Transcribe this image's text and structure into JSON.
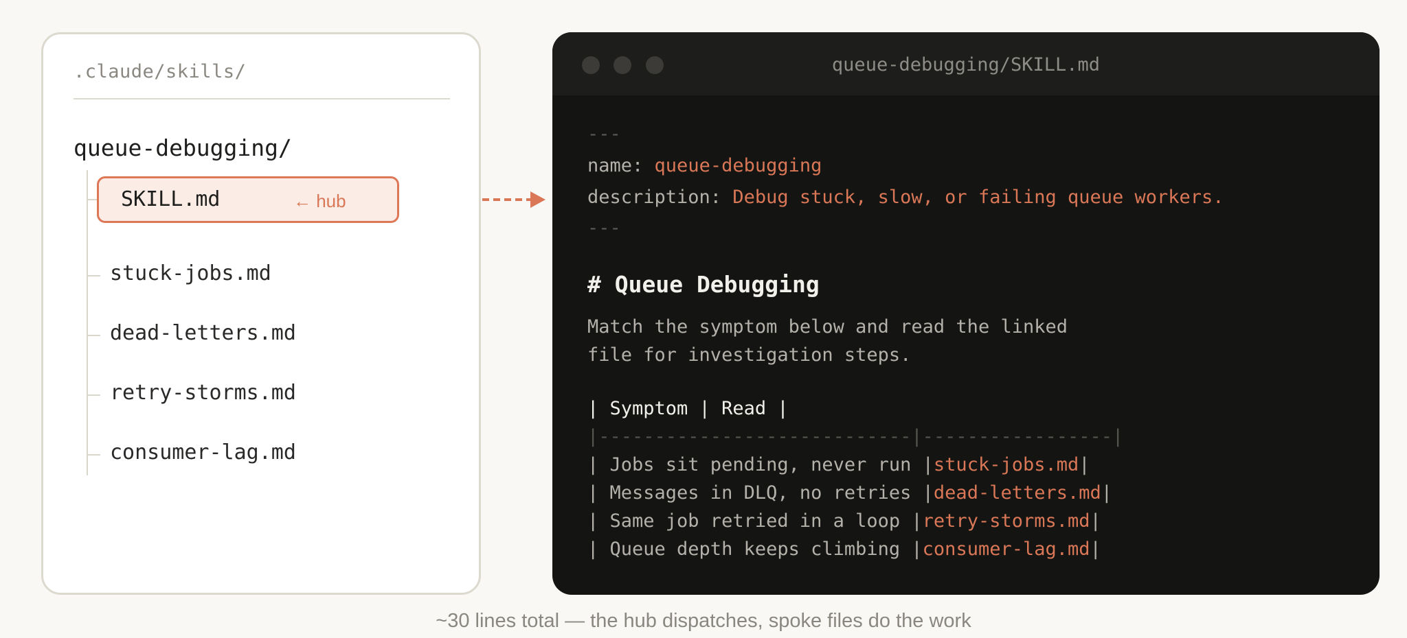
{
  "tree": {
    "root_path": ".claude/skills/",
    "folder": "queue-debugging/",
    "hub_file": "SKILL.md",
    "hub_tag": "← hub",
    "spoke_files": [
      "stuck-jobs.md",
      "dead-letters.md",
      "retry-storms.md",
      "consumer-lag.md"
    ]
  },
  "colors": {
    "accent": "#d97757",
    "code_background": "#141412",
    "page_background": "#f9f8f4"
  },
  "code_window": {
    "title": "queue-debugging/SKILL.md",
    "frontmatter_open": "---",
    "name_key": "name: ",
    "name_value": "queue-debugging",
    "description_key": "description: ",
    "description_value": "Debug stuck, slow, or failing queue workers.",
    "frontmatter_close": "---",
    "heading": "# Queue Debugging",
    "body_line_1": "Match the symptom below and read the linked",
    "body_line_2": "file for investigation steps.",
    "table_header": "| Symptom | Read |",
    "table_separator": "|----------------------------|-----------------|",
    "rows": [
      {
        "symptom": "| Jobs sit pending, never run |",
        "file": "stuck-jobs.md",
        "end": "|"
      },
      {
        "symptom": "| Messages in DLQ, no retries |",
        "file": "dead-letters.md",
        "end": "|"
      },
      {
        "symptom": "| Same job retried in a loop |",
        "file": "retry-storms.md",
        "end": "|"
      },
      {
        "symptom": "| Queue depth keeps climbing |",
        "file": "consumer-lag.md",
        "end": "|"
      }
    ]
  },
  "caption": "~30 lines total — the hub dispatches, spoke files do the work"
}
